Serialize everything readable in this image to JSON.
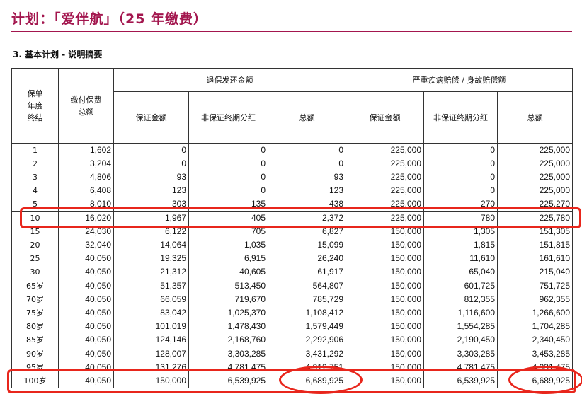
{
  "title": "计划：「爱伴航」（25 年缴费）",
  "section_title": "3. 基本计划 - 说明摘要",
  "headers": {
    "col_year": "保单\n年度\n终结",
    "col_premium": "缴付保费\n总额",
    "group_surrender": "退保发还金额",
    "group_death": "严重疾病赔偿 / 身故赔偿额",
    "guaranteed": "保证金额",
    "non_guaranteed": "非保证终期分红",
    "total": "总额"
  },
  "groups": [
    [
      [
        "1",
        "1,602",
        "0",
        "0",
        "0",
        "225,000",
        "0",
        "225,000"
      ],
      [
        "2",
        "3,204",
        "0",
        "0",
        "0",
        "225,000",
        "0",
        "225,000"
      ],
      [
        "3",
        "4,806",
        "93",
        "0",
        "93",
        "225,000",
        "0",
        "225,000"
      ],
      [
        "4",
        "6,408",
        "123",
        "0",
        "123",
        "225,000",
        "0",
        "225,000"
      ],
      [
        "5",
        "8,010",
        "303",
        "135",
        "438",
        "225,000",
        "270",
        "225,270"
      ]
    ],
    [
      [
        "10",
        "16,020",
        "1,967",
        "405",
        "2,372",
        "225,000",
        "780",
        "225,780"
      ],
      [
        "15",
        "24,030",
        "6,122",
        "705",
        "6,827",
        "150,000",
        "1,305",
        "151,305"
      ],
      [
        "20",
        "32,040",
        "14,064",
        "1,035",
        "15,099",
        "150,000",
        "1,815",
        "151,815"
      ],
      [
        "25",
        "40,050",
        "19,325",
        "6,915",
        "26,240",
        "150,000",
        "11,610",
        "161,610"
      ],
      [
        "30",
        "40,050",
        "21,312",
        "40,605",
        "61,917",
        "150,000",
        "65,040",
        "215,040"
      ]
    ],
    [
      [
        "65岁",
        "40,050",
        "51,357",
        "513,450",
        "564,807",
        "150,000",
        "601,725",
        "751,725"
      ],
      [
        "70岁",
        "40,050",
        "66,059",
        "719,670",
        "785,729",
        "150,000",
        "812,355",
        "962,355"
      ],
      [
        "75岁",
        "40,050",
        "83,042",
        "1,025,370",
        "1,108,412",
        "150,000",
        "1,116,600",
        "1,266,600"
      ],
      [
        "80岁",
        "40,050",
        "101,019",
        "1,478,430",
        "1,579,449",
        "150,000",
        "1,554,285",
        "1,704,285"
      ],
      [
        "85岁",
        "40,050",
        "124,146",
        "2,168,760",
        "2,292,906",
        "150,000",
        "2,190,450",
        "2,340,450"
      ]
    ],
    [
      [
        "90岁",
        "40,050",
        "128,007",
        "3,303,285",
        "3,431,292",
        "150,000",
        "3,303,285",
        "3,453,285"
      ],
      [
        "95岁",
        "40,050",
        "131,276",
        "4,781,475",
        "4,912,751",
        "150,000",
        "4,781,475",
        "4,931,475"
      ],
      [
        "100岁",
        "40,050",
        "150,000",
        "6,539,925",
        "6,689,925",
        "150,000",
        "6,539,925",
        "6,689,925"
      ]
    ]
  ],
  "annotation_color": "#e8261c",
  "title_color": "#a3164e"
}
